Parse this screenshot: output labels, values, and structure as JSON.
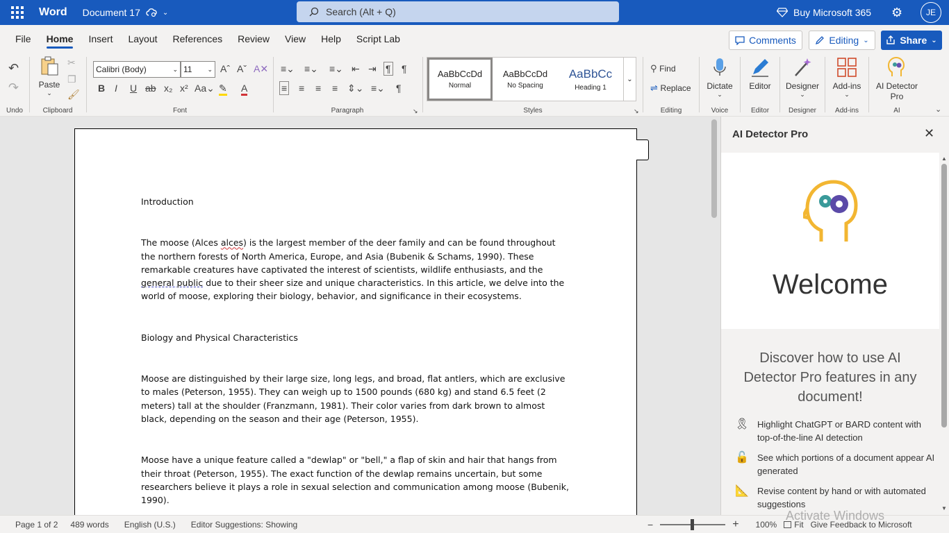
{
  "titlebar": {
    "app_name": "Word",
    "doc_name": "Document 17",
    "search_placeholder": "Search (Alt + Q)",
    "buy_label": "Buy Microsoft 365",
    "avatar_initials": "JE"
  },
  "menu": {
    "tabs": [
      "File",
      "Home",
      "Insert",
      "Layout",
      "References",
      "Review",
      "View",
      "Help",
      "Script Lab"
    ],
    "active_tab": "Home",
    "comments_label": "Comments",
    "editing_label": "Editing",
    "share_label": "Share"
  },
  "ribbon": {
    "undo_group": "Undo",
    "clipboard_group": "Clipboard",
    "paste_label": "Paste",
    "font_name": "Calibri (Body)",
    "font_size": "11",
    "font_group": "Font",
    "paragraph_group": "Paragraph",
    "styles": [
      {
        "preview": "AaBbCcDd",
        "name": "Normal"
      },
      {
        "preview": "AaBbCcDd",
        "name": "No Spacing"
      },
      {
        "preview": "AaBbCc",
        "name": "Heading 1"
      }
    ],
    "styles_group": "Styles",
    "find_label": "Find",
    "replace_label": "Replace",
    "editing_group": "Editing",
    "dictate_label": "Dictate",
    "voice_group": "Voice",
    "editor_label": "Editor",
    "editor_group": "Editor",
    "designer_label": "Designer",
    "designer_group": "Designer",
    "addins_label": "Add-ins",
    "addins_group": "Add-ins",
    "aidetector_label_1": "AI Detector",
    "aidetector_label_2": "Pro",
    "ai_group": "AI"
  },
  "document": {
    "heading1": "Introduction",
    "para1_a": "The moose (Alces ",
    "para1_err": "alces",
    "para1_b": ") is the largest member of the deer family and can be found throughout the northern forests of North America, Europe, and Asia (Bubenik & Schams, 1990). These remarkable creatures have captivated the interest of scientists, wildlife enthusiasts, and the ",
    "para1_sugg": "general public",
    "para1_c": " due to their sheer size and unique characteristics. In this article, we delve into the world of moose, exploring their biology, behavior, and significance in their ecosystems.",
    "heading2": "Biology and Physical Characteristics",
    "para2": "Moose are distinguished by their large size, long legs, and broad, flat antlers, which are exclusive to males (Peterson, 1955). They can weigh up to 1500 pounds (680 kg) and stand 6.5 feet (2 meters) tall at the shoulder (Franzmann, 1981). Their color varies from dark brown to almost black, depending on the season and their age (Peterson, 1955).",
    "para3": "Moose have a unique feature called a \"dewlap\" or \"bell,\" a flap of skin and hair that hangs from their throat (Peterson, 1955). The exact function of the dewlap remains uncertain, but some researchers believe it plays a role in sexual selection and communication among moose (Bubenik, 1990)."
  },
  "pane": {
    "title": "AI Detector Pro",
    "welcome": "Welcome",
    "discover": "Discover how to use AI Detector Pro features in any document!",
    "features": [
      {
        "icon": "ribbon-award-icon",
        "text": "Highlight ChatGPT or BARD content with top-of-the-line AI detection"
      },
      {
        "icon": "lock-icon",
        "text": "See which portions of a document appear AI generated"
      },
      {
        "icon": "ruler-pencil-icon",
        "text": "Revise content by hand or with automated suggestions"
      }
    ]
  },
  "status": {
    "page": "Page 1 of 2",
    "words": "489 words",
    "language": "English (U.S.)",
    "editor_suggestions": "Editor Suggestions: Showing",
    "zoom_out": "−",
    "zoom_in": "+",
    "zoom_level": "100%",
    "fit": "Fit",
    "feedback": "Give Feedback to Microsoft",
    "watermark": "Activate Windows"
  },
  "colors": {
    "brand": "#185abd",
    "pane_accent": "#f2b632"
  }
}
